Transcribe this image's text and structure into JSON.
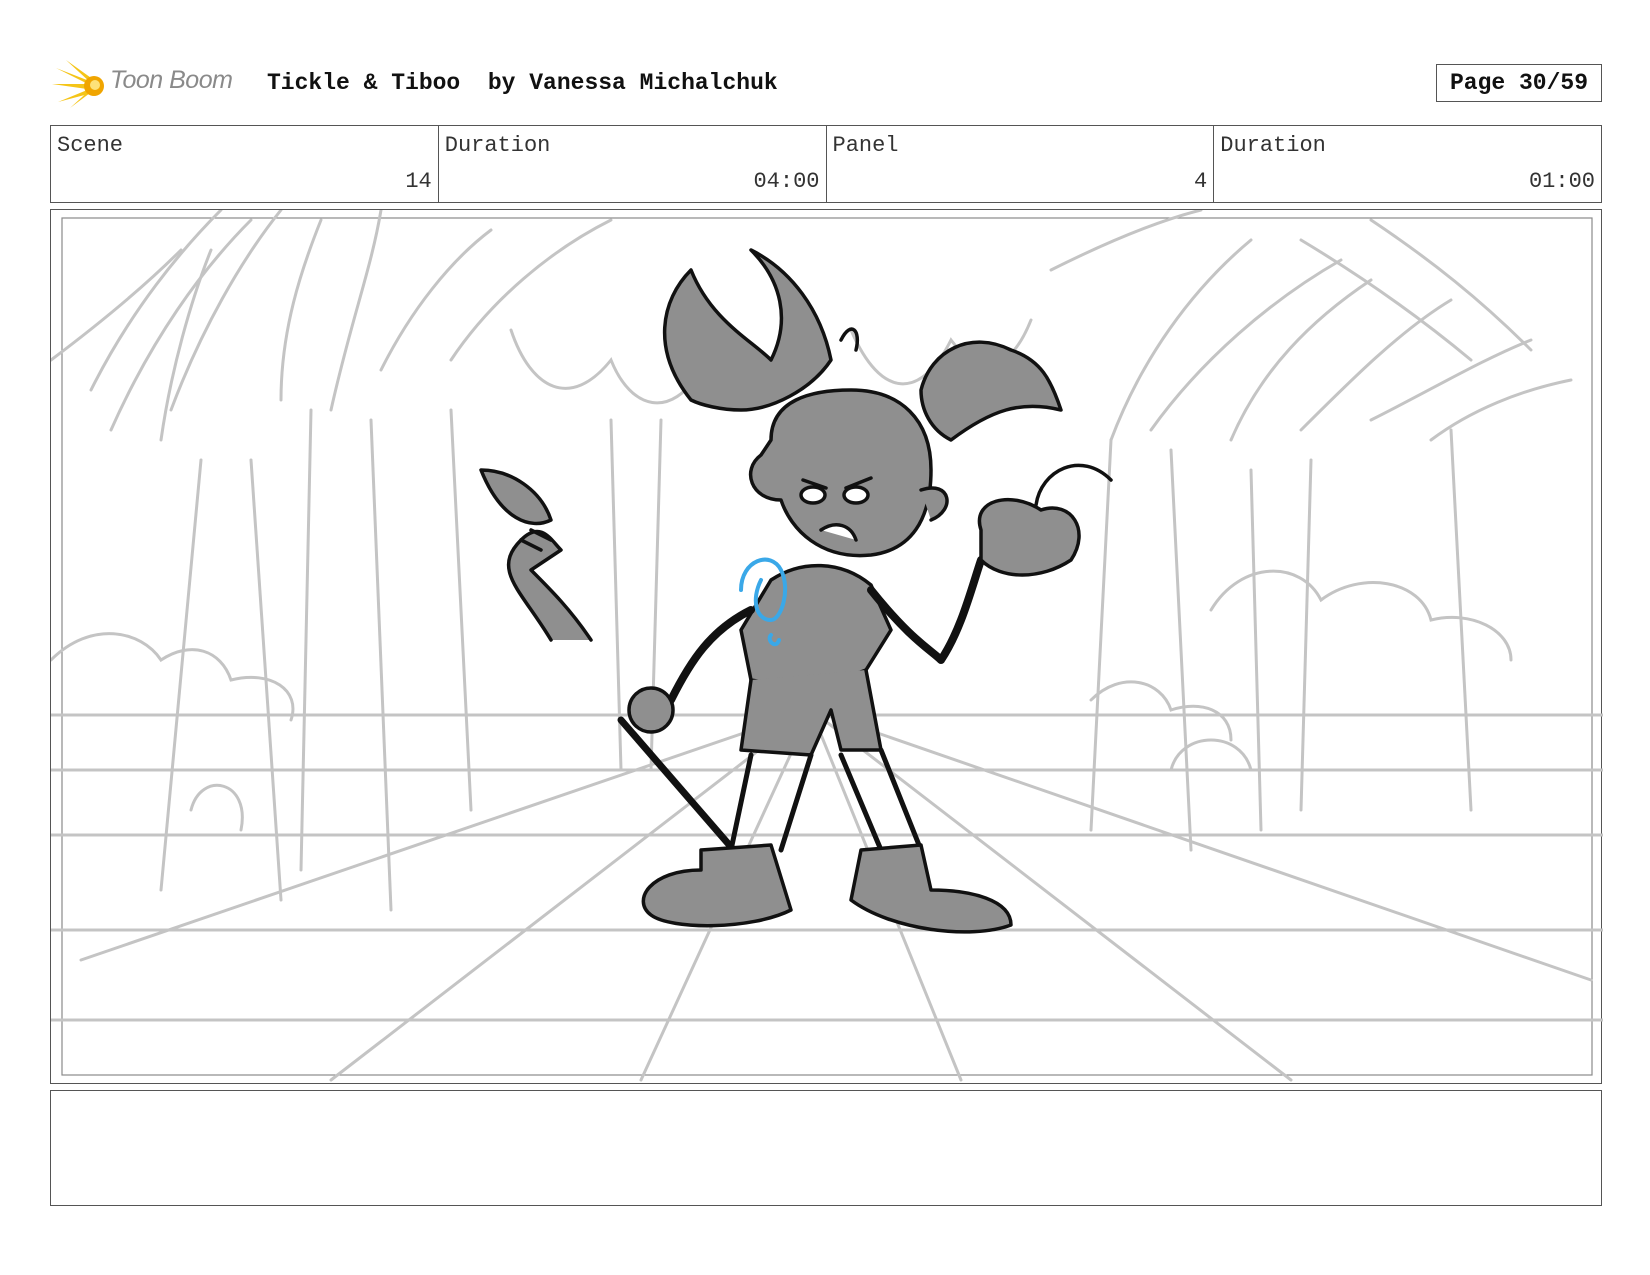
{
  "header": {
    "logo_text": "Toon Boom",
    "title": "Tickle & Tiboo  by Vanessa Michalchuk",
    "page": "Page 30/59"
  },
  "info": {
    "scene_label": "Scene",
    "scene_value": "14",
    "scene_duration_label": "Duration",
    "scene_duration_value": "04:00",
    "panel_label": "Panel",
    "panel_value": "4",
    "panel_duration_label": "Duration",
    "panel_duration_value": "01:00"
  },
  "notes": {
    "text": ""
  },
  "colors": {
    "accent_logo": "#f5c518",
    "sketch_gray": "#c4c4c4",
    "character_fill": "#8f8f8f",
    "highlight_blue": "#3aa8e8"
  }
}
